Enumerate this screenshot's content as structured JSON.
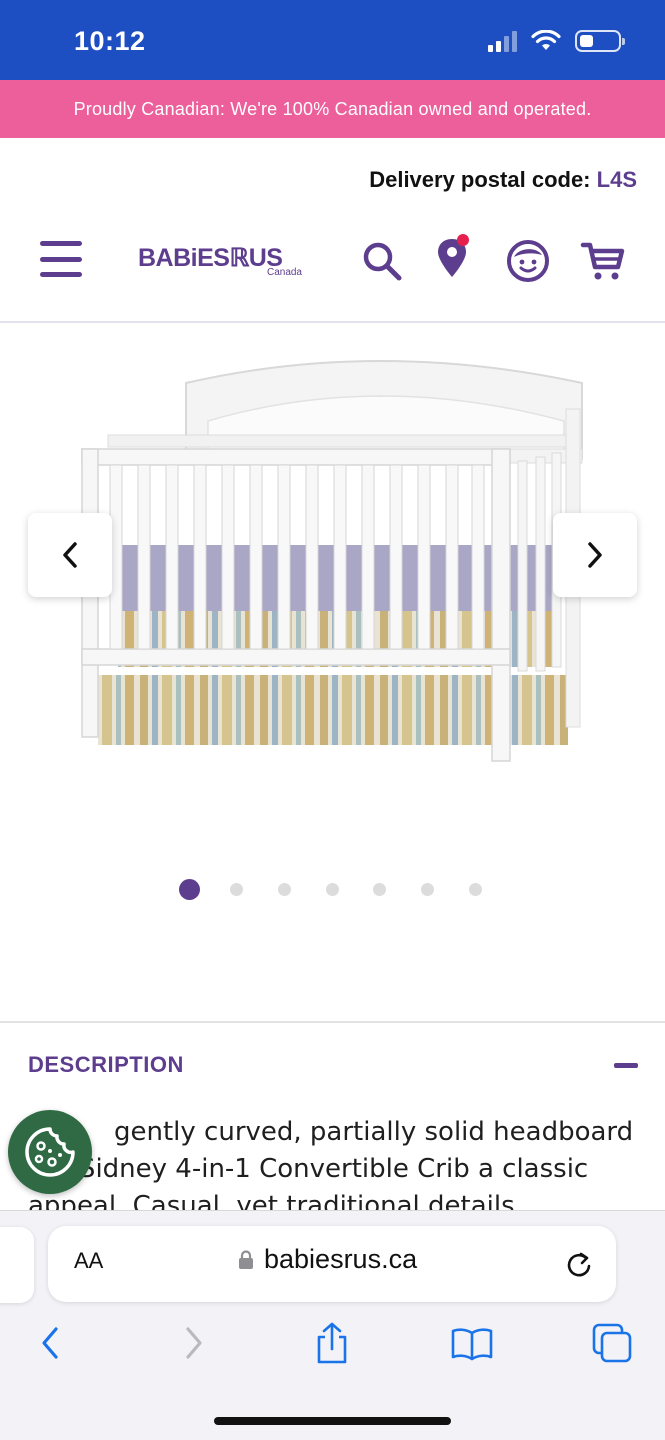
{
  "status_bar": {
    "time": "10:12",
    "battery_level": 0.35
  },
  "promo": {
    "text": "Proudly Canadian: We're 100% Canadian owned and operated."
  },
  "header": {
    "delivery_label": "Delivery postal code:",
    "delivery_code": "L4S",
    "logo_text": "BABiESℝUS",
    "logo_sub": "Canada"
  },
  "colors": {
    "brand_purple": "#5d3e8e",
    "status_blue": "#1e4fc2",
    "promo_pink": "#ec5f9a",
    "cookie_green": "#2f6a44"
  },
  "icons": [
    "menu-icon",
    "search-icon",
    "store-location-icon",
    "account-icon",
    "cart-icon",
    "chevron-left-icon",
    "chevron-right-icon",
    "cookie-icon",
    "lock-icon",
    "reload-icon",
    "back-icon",
    "forward-icon",
    "share-icon",
    "bookmarks-icon",
    "tabs-icon"
  ],
  "gallery": {
    "image_count": 7,
    "active_index": 0
  },
  "description": {
    "heading": "DESCRIPTION",
    "text": "gently curved, partially solid headboard the Sidney 4-in-1 Convertible Crib a classic appeal. Casual, yet traditional details"
  },
  "safari": {
    "text_size_label": "AA",
    "url": "babiesrus.ca"
  }
}
